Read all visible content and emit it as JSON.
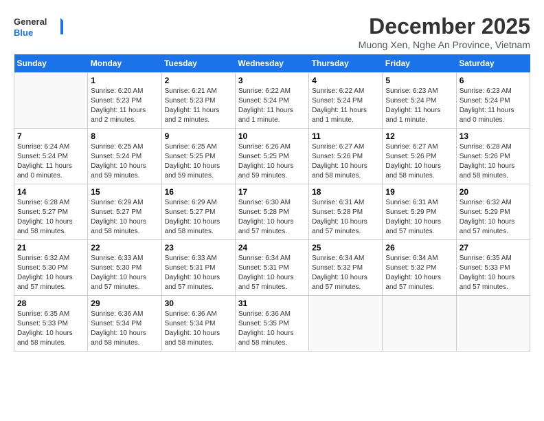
{
  "header": {
    "logo_general": "General",
    "logo_blue": "Blue",
    "month_title": "December 2025",
    "location": "Muong Xen, Nghe An Province, Vietnam"
  },
  "days_of_week": [
    "Sunday",
    "Monday",
    "Tuesday",
    "Wednesday",
    "Thursday",
    "Friday",
    "Saturday"
  ],
  "weeks": [
    [
      {
        "day": "",
        "info": ""
      },
      {
        "day": "1",
        "info": "Sunrise: 6:20 AM\nSunset: 5:23 PM\nDaylight: 11 hours\nand 2 minutes."
      },
      {
        "day": "2",
        "info": "Sunrise: 6:21 AM\nSunset: 5:23 PM\nDaylight: 11 hours\nand 2 minutes."
      },
      {
        "day": "3",
        "info": "Sunrise: 6:22 AM\nSunset: 5:24 PM\nDaylight: 11 hours\nand 1 minute."
      },
      {
        "day": "4",
        "info": "Sunrise: 6:22 AM\nSunset: 5:24 PM\nDaylight: 11 hours\nand 1 minute."
      },
      {
        "day": "5",
        "info": "Sunrise: 6:23 AM\nSunset: 5:24 PM\nDaylight: 11 hours\nand 1 minute."
      },
      {
        "day": "6",
        "info": "Sunrise: 6:23 AM\nSunset: 5:24 PM\nDaylight: 11 hours\nand 0 minutes."
      }
    ],
    [
      {
        "day": "7",
        "info": "Sunrise: 6:24 AM\nSunset: 5:24 PM\nDaylight: 11 hours\nand 0 minutes."
      },
      {
        "day": "8",
        "info": "Sunrise: 6:25 AM\nSunset: 5:24 PM\nDaylight: 10 hours\nand 59 minutes."
      },
      {
        "day": "9",
        "info": "Sunrise: 6:25 AM\nSunset: 5:25 PM\nDaylight: 10 hours\nand 59 minutes."
      },
      {
        "day": "10",
        "info": "Sunrise: 6:26 AM\nSunset: 5:25 PM\nDaylight: 10 hours\nand 59 minutes."
      },
      {
        "day": "11",
        "info": "Sunrise: 6:27 AM\nSunset: 5:26 PM\nDaylight: 10 hours\nand 58 minutes."
      },
      {
        "day": "12",
        "info": "Sunrise: 6:27 AM\nSunset: 5:26 PM\nDaylight: 10 hours\nand 58 minutes."
      },
      {
        "day": "13",
        "info": "Sunrise: 6:28 AM\nSunset: 5:26 PM\nDaylight: 10 hours\nand 58 minutes."
      }
    ],
    [
      {
        "day": "14",
        "info": "Sunrise: 6:28 AM\nSunset: 5:27 PM\nDaylight: 10 hours\nand 58 minutes."
      },
      {
        "day": "15",
        "info": "Sunrise: 6:29 AM\nSunset: 5:27 PM\nDaylight: 10 hours\nand 58 minutes."
      },
      {
        "day": "16",
        "info": "Sunrise: 6:29 AM\nSunset: 5:27 PM\nDaylight: 10 hours\nand 58 minutes."
      },
      {
        "day": "17",
        "info": "Sunrise: 6:30 AM\nSunset: 5:28 PM\nDaylight: 10 hours\nand 57 minutes."
      },
      {
        "day": "18",
        "info": "Sunrise: 6:31 AM\nSunset: 5:28 PM\nDaylight: 10 hours\nand 57 minutes."
      },
      {
        "day": "19",
        "info": "Sunrise: 6:31 AM\nSunset: 5:29 PM\nDaylight: 10 hours\nand 57 minutes."
      },
      {
        "day": "20",
        "info": "Sunrise: 6:32 AM\nSunset: 5:29 PM\nDaylight: 10 hours\nand 57 minutes."
      }
    ],
    [
      {
        "day": "21",
        "info": "Sunrise: 6:32 AM\nSunset: 5:30 PM\nDaylight: 10 hours\nand 57 minutes."
      },
      {
        "day": "22",
        "info": "Sunrise: 6:33 AM\nSunset: 5:30 PM\nDaylight: 10 hours\nand 57 minutes."
      },
      {
        "day": "23",
        "info": "Sunrise: 6:33 AM\nSunset: 5:31 PM\nDaylight: 10 hours\nand 57 minutes."
      },
      {
        "day": "24",
        "info": "Sunrise: 6:34 AM\nSunset: 5:31 PM\nDaylight: 10 hours\nand 57 minutes."
      },
      {
        "day": "25",
        "info": "Sunrise: 6:34 AM\nSunset: 5:32 PM\nDaylight: 10 hours\nand 57 minutes."
      },
      {
        "day": "26",
        "info": "Sunrise: 6:34 AM\nSunset: 5:32 PM\nDaylight: 10 hours\nand 57 minutes."
      },
      {
        "day": "27",
        "info": "Sunrise: 6:35 AM\nSunset: 5:33 PM\nDaylight: 10 hours\nand 57 minutes."
      }
    ],
    [
      {
        "day": "28",
        "info": "Sunrise: 6:35 AM\nSunset: 5:33 PM\nDaylight: 10 hours\nand 58 minutes."
      },
      {
        "day": "29",
        "info": "Sunrise: 6:36 AM\nSunset: 5:34 PM\nDaylight: 10 hours\nand 58 minutes."
      },
      {
        "day": "30",
        "info": "Sunrise: 6:36 AM\nSunset: 5:34 PM\nDaylight: 10 hours\nand 58 minutes."
      },
      {
        "day": "31",
        "info": "Sunrise: 6:36 AM\nSunset: 5:35 PM\nDaylight: 10 hours\nand 58 minutes."
      },
      {
        "day": "",
        "info": ""
      },
      {
        "day": "",
        "info": ""
      },
      {
        "day": "",
        "info": ""
      }
    ]
  ]
}
